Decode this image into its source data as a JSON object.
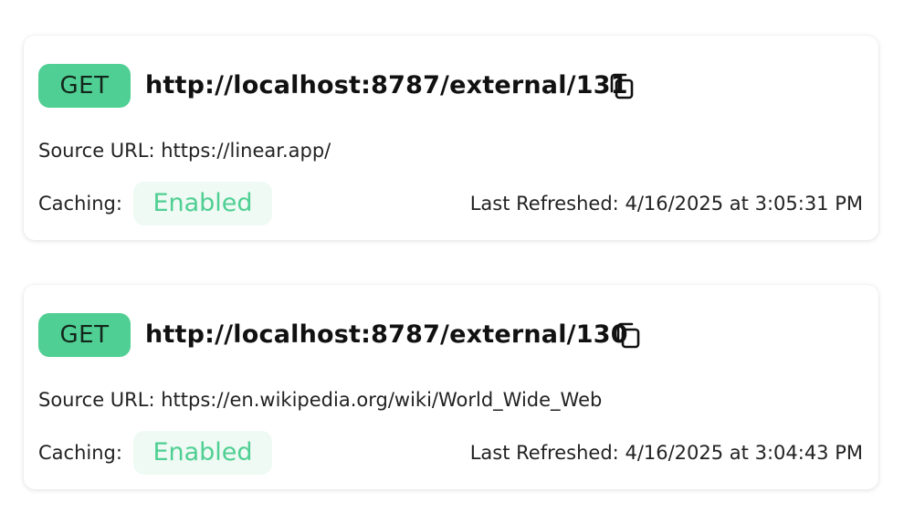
{
  "colors": {
    "method_bg": "#4fcf93",
    "badge_bg": "#eefaf3",
    "badge_text": "#4fcf93"
  },
  "endpoints": [
    {
      "method": "GET",
      "url": "http://localhost:8787/external/131",
      "copy_icon": "copy-icon",
      "source_label": "Source URL:",
      "source_url": "https://linear.app/",
      "caching_label": "Caching:",
      "caching_status": "Enabled",
      "refreshed_label": "Last Refreshed:",
      "refreshed_at": "4/16/2025 at 3:05:31 PM"
    },
    {
      "method": "GET",
      "url": "http://localhost:8787/external/130",
      "copy_icon": "copy-icon",
      "source_label": "Source URL:",
      "source_url": "https://en.wikipedia.org/wiki/World_Wide_Web",
      "caching_label": "Caching:",
      "caching_status": "Enabled",
      "refreshed_label": "Last Refreshed:",
      "refreshed_at": "4/16/2025 at 3:04:43 PM"
    }
  ]
}
